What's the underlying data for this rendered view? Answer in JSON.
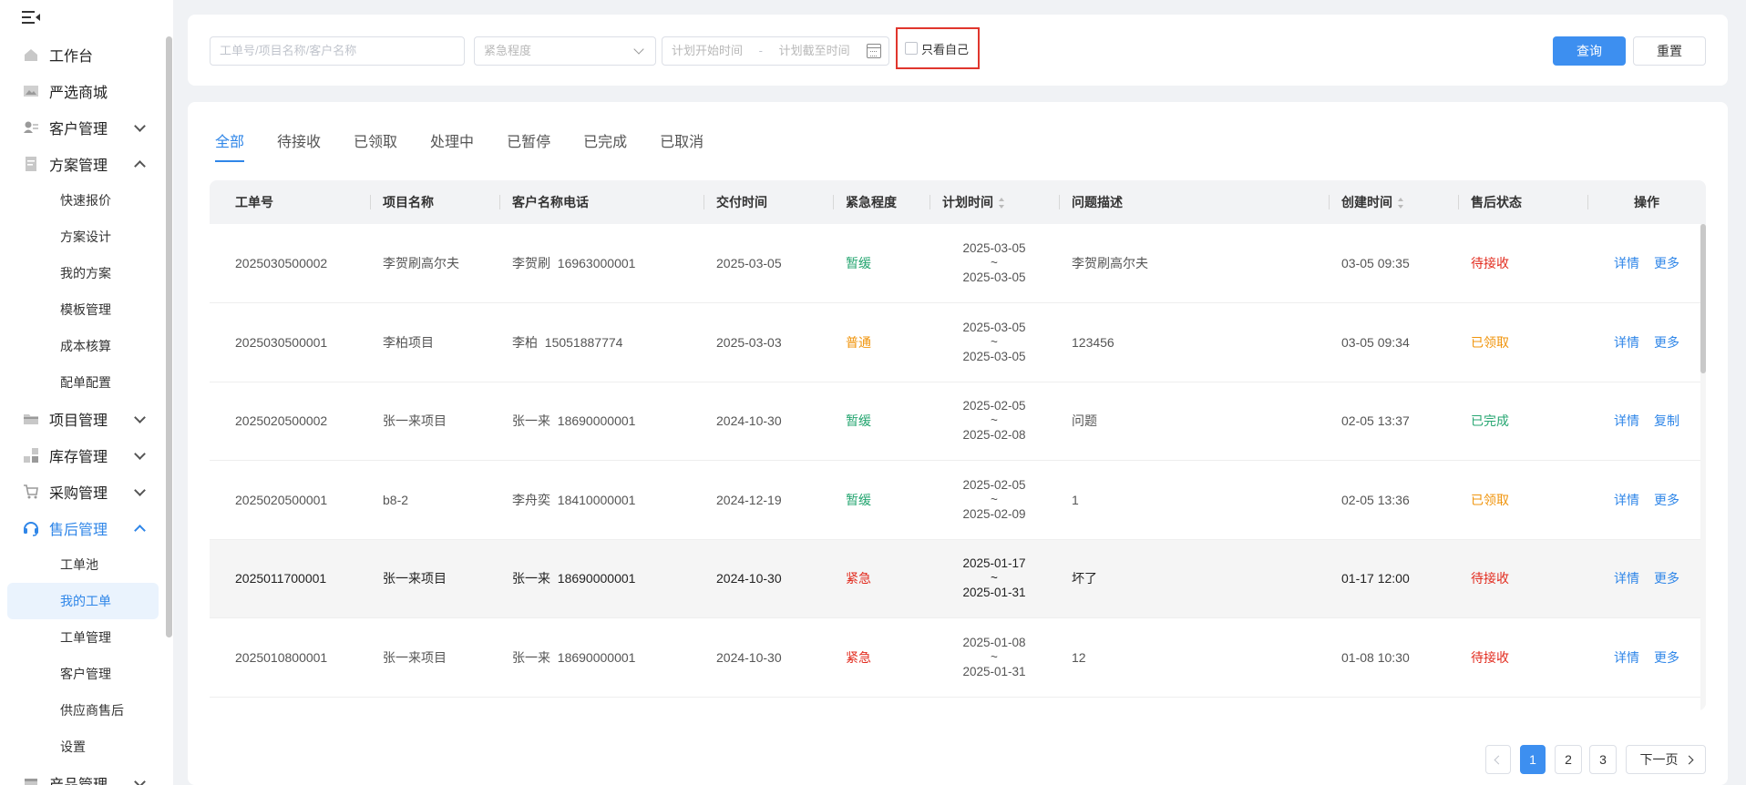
{
  "sidebar": {
    "items": [
      {
        "label": "工作台",
        "icon": "home-icon"
      },
      {
        "label": "严选商城",
        "icon": "image-icon"
      },
      {
        "label": "客户管理",
        "icon": "user-card-icon",
        "expanded": false
      },
      {
        "label": "方案管理",
        "icon": "document-icon",
        "expanded": true,
        "children": [
          "快速报价",
          "方案设计",
          "我的方案",
          "模板管理",
          "成本核算",
          "配单配置"
        ]
      },
      {
        "label": "项目管理",
        "icon": "folder-icon",
        "expanded": false
      },
      {
        "label": "库存管理",
        "icon": "blocks-icon",
        "expanded": false
      },
      {
        "label": "采购管理",
        "icon": "cart-icon",
        "expanded": false
      },
      {
        "label": "售后管理",
        "icon": "headset-icon",
        "expanded": true,
        "active": true,
        "children": [
          "工单池",
          "我的工单",
          "工单管理",
          "客户管理",
          "供应商售后",
          "设置"
        ]
      },
      {
        "label": "产品管理",
        "icon": "box-icon",
        "expanded": false
      }
    ],
    "selected_child": "我的工单"
  },
  "filter": {
    "keyword_placeholder": "工单号/项目名称/客户名称",
    "urgency_placeholder": "紧急程度",
    "date_start_placeholder": "计划开始时间",
    "date_sep": "-",
    "date_end_placeholder": "计划截至时间",
    "only_me_label": "只看自己",
    "only_me_checked": false,
    "query_label": "查询",
    "reset_label": "重置"
  },
  "tabs": [
    "全部",
    "待接收",
    "已领取",
    "处理中",
    "已暂停",
    "已完成",
    "已取消"
  ],
  "active_tab": "全部",
  "table": {
    "columns": [
      "工单号",
      "项目名称",
      "客户名称电话",
      "交付时间",
      "紧急程度",
      "计划时间",
      "问题描述",
      "创建时间",
      "售后状态",
      "操作"
    ],
    "rows": [
      {
        "id": "2025030500002",
        "project": "李贺刷高尔夫",
        "customer": "李贺刷  16963000001",
        "delivery": "2025-03-05",
        "urgency": "暂缓",
        "plan_start": "2025-03-05",
        "plan_sep": "~",
        "plan_end": "2025-03-05",
        "desc": "李贺刷高尔夫",
        "created": "03-05 09:35",
        "status": "待接收",
        "op1": "详情",
        "op2": "更多"
      },
      {
        "id": "2025030500001",
        "project": "李柏项目",
        "customer": "李柏  15051887774",
        "delivery": "2025-03-03",
        "urgency": "普通",
        "plan_start": "2025-03-05",
        "plan_sep": "~",
        "plan_end": "2025-03-05",
        "desc": "123456",
        "created": "03-05 09:34",
        "status": "已领取",
        "op1": "详情",
        "op2": "更多"
      },
      {
        "id": "2025020500002",
        "project": "张一来项目",
        "customer": "张一来  18690000001",
        "delivery": "2024-10-30",
        "urgency": "暂缓",
        "plan_start": "2025-02-05",
        "plan_sep": "~",
        "plan_end": "2025-02-08",
        "desc": "问题",
        "created": "02-05 13:37",
        "status": "已完成",
        "op1": "详情",
        "op2": "复制"
      },
      {
        "id": "2025020500001",
        "project": "b8-2",
        "customer": "李舟奕  18410000001",
        "delivery": "2024-12-19",
        "urgency": "暂缓",
        "plan_start": "2025-02-05",
        "plan_sep": "~",
        "plan_end": "2025-02-09",
        "desc": "1",
        "created": "02-05 13:36",
        "status": "已领取",
        "op1": "详情",
        "op2": "更多"
      },
      {
        "id": "2025011700001",
        "project": "张一来项目",
        "customer": "张一来  18690000001",
        "delivery": "2024-10-30",
        "urgency": "紧急",
        "plan_start": "2025-01-17",
        "plan_sep": "~",
        "plan_end": "2025-01-31",
        "desc": "坏了",
        "created": "01-17 12:00",
        "status": "待接收",
        "op1": "详情",
        "op2": "更多"
      },
      {
        "id": "2025010800001",
        "project": "张一来项目",
        "customer": "张一来  18690000001",
        "delivery": "2024-10-30",
        "urgency": "紧急",
        "plan_start": "2025-01-08",
        "plan_sep": "~",
        "plan_end": "2025-01-31",
        "desc": "12",
        "created": "01-08 10:30",
        "status": "待接收",
        "op1": "详情",
        "op2": "更多"
      }
    ]
  },
  "pagination": {
    "pages": [
      "1",
      "2",
      "3"
    ],
    "current": "1",
    "next_label": "下一页"
  },
  "colors": {
    "primary": "#3d8ff0",
    "green": "#26a671",
    "orange": "#f0940c",
    "red": "#e22b1e",
    "highlight_border": "#e0362d"
  }
}
